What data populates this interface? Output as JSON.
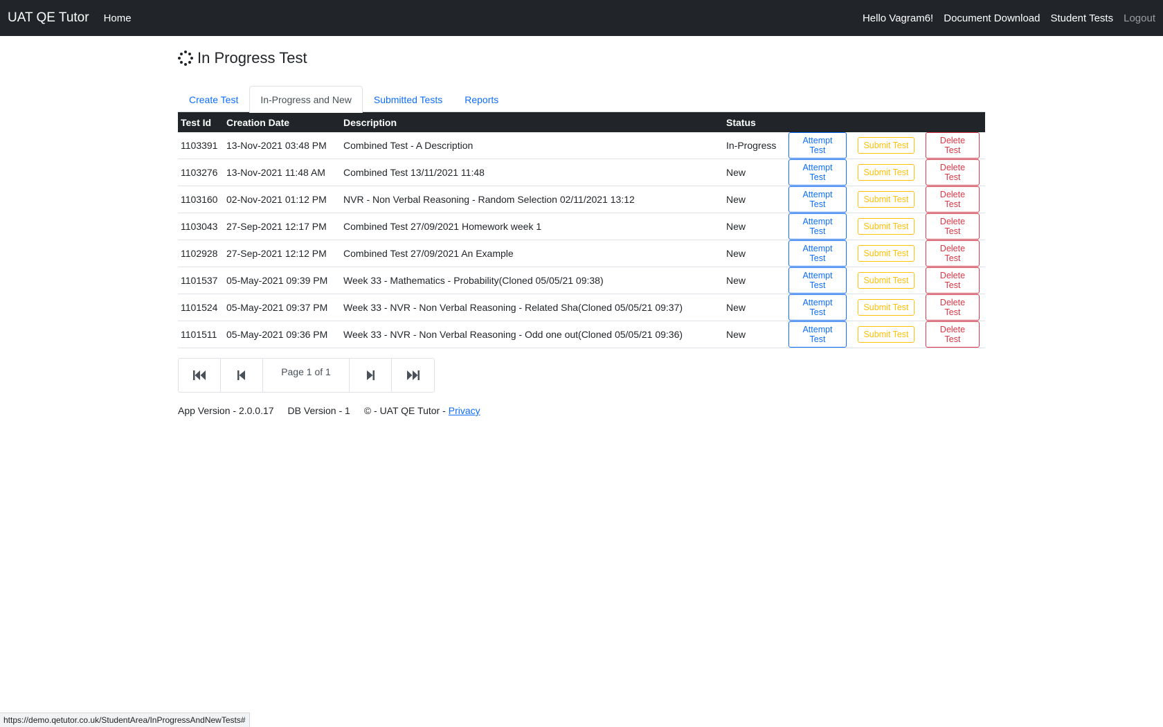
{
  "navbar": {
    "brand": "UAT QE Tutor",
    "home": "Home",
    "greeting": "Hello Vagram6!",
    "document_download": "Document Download",
    "student_tests": "Student Tests",
    "logout": "Logout"
  },
  "page": {
    "title": "In Progress Test",
    "icon": "spinner-icon"
  },
  "tabs": [
    {
      "label": "Create Test"
    },
    {
      "label": "In-Progress and New"
    },
    {
      "label": "Submitted Tests"
    },
    {
      "label": "Reports"
    }
  ],
  "table": {
    "headers": [
      "Test Id",
      "Creation Date",
      "Description",
      "Status"
    ],
    "rows": [
      {
        "id": "1103391",
        "date": "13-Nov-2021 03:48 PM",
        "description": "Combined Test - A Description",
        "status": "In-Progress"
      },
      {
        "id": "1103276",
        "date": "13-Nov-2021 11:48 AM",
        "description": "Combined Test 13/11/2021 11:48",
        "status": "New"
      },
      {
        "id": "1103160",
        "date": "02-Nov-2021 01:12 PM",
        "description": "NVR - Non Verbal Reasoning - Random Selection 02/11/2021 13:12",
        "status": "New"
      },
      {
        "id": "1103043",
        "date": "27-Sep-2021 12:17 PM",
        "description": "Combined Test 27/09/2021 Homework week 1",
        "status": "New"
      },
      {
        "id": "1102928",
        "date": "27-Sep-2021 12:12 PM",
        "description": "Combined Test 27/09/2021 An Example",
        "status": "New"
      },
      {
        "id": "1101537",
        "date": "05-May-2021 09:39 PM",
        "description": "Week 33 - Mathematics - Probability(Cloned 05/05/21 09:38)",
        "status": "New"
      },
      {
        "id": "1101524",
        "date": "05-May-2021 09:37 PM",
        "description": "Week 33 - NVR - Non Verbal Reasoning - Related Sha(Cloned 05/05/21 09:37)",
        "status": "New"
      },
      {
        "id": "1101511",
        "date": "05-May-2021 09:36 PM",
        "description": "Week 33 - NVR - Non Verbal Reasoning - Odd one out(Cloned 05/05/21 09:36)",
        "status": "New"
      }
    ],
    "actions": {
      "attempt": "Attempt Test",
      "submit": "Submit Test",
      "delete": "Delete Test"
    }
  },
  "pager": {
    "text": "Page 1 of   1",
    "icons": [
      "first-page-icon",
      "previous-page-icon",
      "next-page-icon",
      "last-page-icon"
    ]
  },
  "footer": {
    "app_version": "App Version - 2.0.0.17",
    "db_version": "DB Version - 1",
    "copyright": "© - UAT QE Tutor -",
    "privacy": "Privacy"
  },
  "status_bar": {
    "url": "https://demo.qetutor.co.uk/StudentArea/InProgressAndNewTests#"
  },
  "colors": {
    "navbar": "#212529",
    "primary": "#0d6efd",
    "warning": "#ffc107",
    "danger": "#dc3545"
  }
}
